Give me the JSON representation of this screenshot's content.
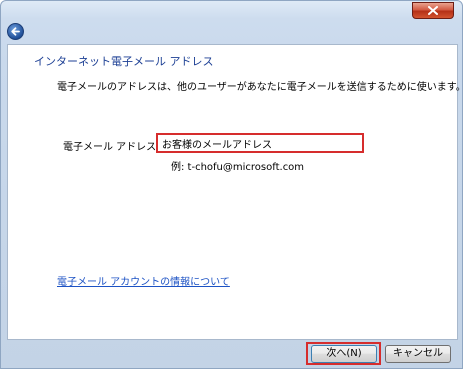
{
  "window": {
    "close_icon": "close-icon",
    "back_icon": "back-arrow-icon"
  },
  "main": {
    "heading": "インターネット電子メール アドレス",
    "description": "電子メールのアドレスは、他のユーザーがあなたに電子メールを送信するために使います。",
    "email_label": "電子メール アドレス(E):",
    "email_value": "お客様のメールアドレス",
    "example": "例: t-chofu@microsoft.com",
    "help_link": "電子メール アカウントの情報について"
  },
  "footer": {
    "next_label": "次へ(N)",
    "cancel_label": "キャンセル"
  },
  "colors": {
    "highlight": "#d62d2d",
    "heading": "#1c3f94",
    "link": "#1c52c4"
  }
}
